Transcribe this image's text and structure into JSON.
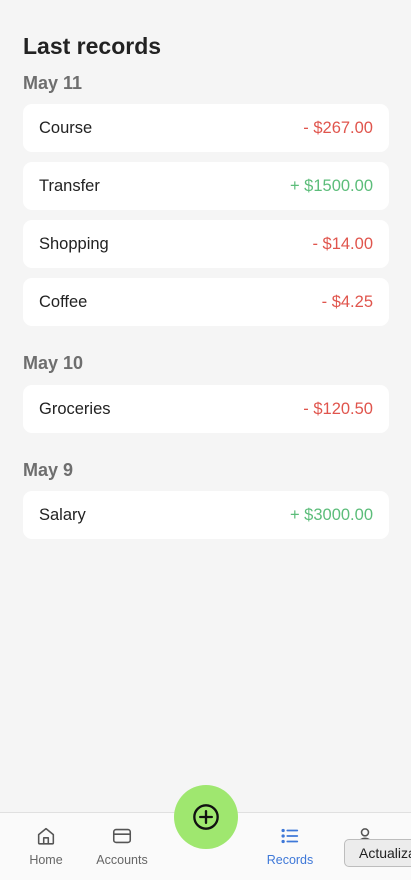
{
  "page": {
    "title": "Last records"
  },
  "groups": [
    {
      "date": "May 11",
      "records": [
        {
          "name": "Course",
          "amount": "- $267.00",
          "type": "negative"
        },
        {
          "name": "Transfer",
          "amount": "+ $1500.00",
          "type": "positive"
        },
        {
          "name": "Shopping",
          "amount": "- $14.00",
          "type": "negative"
        },
        {
          "name": "Coffee",
          "amount": "- $4.25",
          "type": "negative"
        }
      ]
    },
    {
      "date": "May 10",
      "records": [
        {
          "name": "Groceries",
          "amount": "- $120.50",
          "type": "negative"
        }
      ]
    },
    {
      "date": "May 9",
      "records": [
        {
          "name": "Salary",
          "amount": "+ $3000.00",
          "type": "positive"
        }
      ]
    }
  ],
  "nav": {
    "home_label": "Home",
    "accounts_label": "Accounts",
    "records_label": "Records",
    "active": "records"
  },
  "fab": {
    "icon": "plus-circle-icon"
  },
  "tooltip": {
    "text": "Actualiza"
  },
  "colors": {
    "negative": "#e0554d",
    "positive": "#5cbd7a",
    "accent": "#3e78d8",
    "fab": "#9fe76f"
  }
}
